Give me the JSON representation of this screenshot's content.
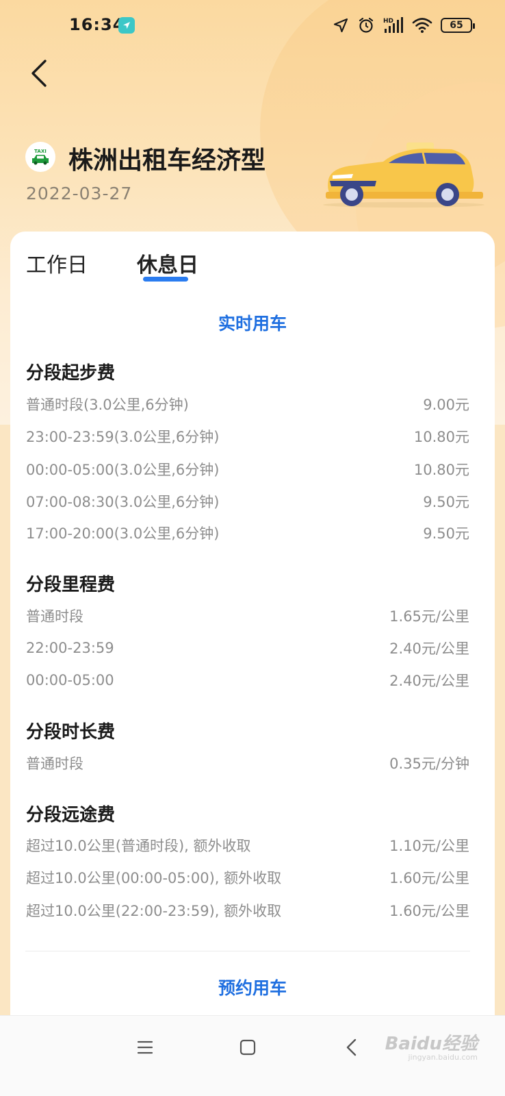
{
  "status_bar": {
    "time": "16:34",
    "battery": "65",
    "icons": [
      "navigation-app-icon",
      "location-icon",
      "alarm-icon",
      "signal-hd-icon",
      "wifi-icon",
      "battery-icon"
    ]
  },
  "header": {
    "title": "株洲出租车经济型",
    "date": "2022-03-27",
    "badge_text": "TAXI"
  },
  "tabs": [
    {
      "label": "工作日",
      "selected": false
    },
    {
      "label": "休息日",
      "selected": true
    }
  ],
  "realtime_label": "实时用车",
  "sections": {
    "start": {
      "title": "分段起步费",
      "rows": [
        {
          "label": "普通时段(3.0公里,6分钟)",
          "value": "9.00元"
        },
        {
          "label": "23:00-23:59(3.0公里,6分钟)",
          "value": "10.80元"
        },
        {
          "label": "00:00-05:00(3.0公里,6分钟)",
          "value": "10.80元"
        },
        {
          "label": "07:00-08:30(3.0公里,6分钟)",
          "value": "9.50元"
        },
        {
          "label": "17:00-20:00(3.0公里,6分钟)",
          "value": "9.50元"
        }
      ]
    },
    "mileage": {
      "title": "分段里程费",
      "rows": [
        {
          "label": "普通时段",
          "value": "1.65元/公里"
        },
        {
          "label": "22:00-23:59",
          "value": "2.40元/公里"
        },
        {
          "label": "00:00-05:00",
          "value": "2.40元/公里"
        }
      ]
    },
    "duration": {
      "title": "分段时长费",
      "rows": [
        {
          "label": "普通时段",
          "value": "0.35元/分钟"
        }
      ]
    },
    "long_distance": {
      "title": "分段远途费",
      "rows": [
        {
          "label": "超过10.0公里(普通时段), 额外收取",
          "value": "1.10元/公里"
        },
        {
          "label": "超过10.0公里(00:00-05:00), 额外收取",
          "value": "1.60元/公里"
        },
        {
          "label": "超过10.0公里(22:00-23:59), 额外收取",
          "value": "1.60元/公里"
        }
      ]
    }
  },
  "reserve_label": "预约用车",
  "watermark": {
    "text": "Baidu经验",
    "sub": "jingyan.baidu.com"
  },
  "colors": {
    "accent": "#1f6fe0",
    "tab_indicator": "#2a7cf0",
    "header_bg": "#fbd9a0",
    "taxi_yellow": "#f8c64a"
  }
}
